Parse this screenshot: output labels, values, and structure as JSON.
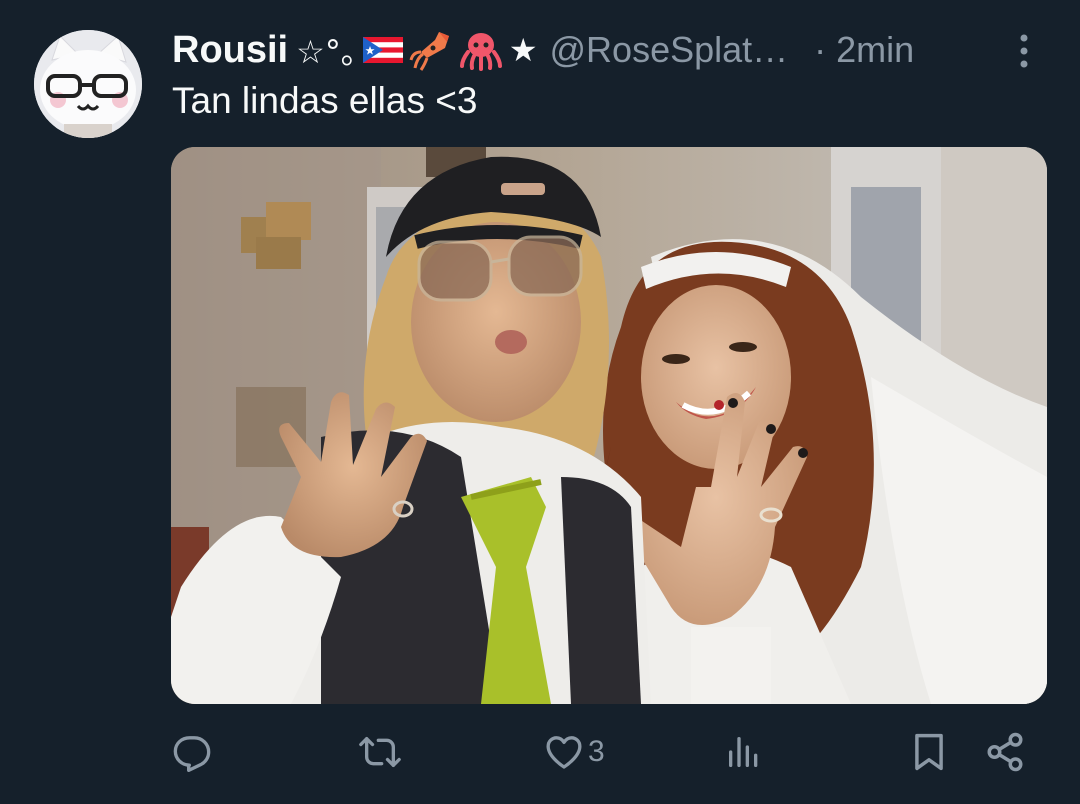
{
  "tweet": {
    "author": {
      "display_name": "Rousii",
      "name_decorations": "☆°｡",
      "emoji_icons": [
        "puerto-rico-flag-icon",
        "squid-icon",
        "octopus-icon"
      ],
      "name_trailing": "★",
      "handle": "@RoseSplat…",
      "avatar_icon": "cat-with-glasses-avatar-icon"
    },
    "time": "· 2min",
    "text": "Tan lindas ellas <3",
    "media_icon": "photo-two-women-showing-rings"
  },
  "actions": {
    "reply": {
      "icon": "reply-icon",
      "count": ""
    },
    "repost": {
      "icon": "repost-icon",
      "count": ""
    },
    "like": {
      "icon": "heart-icon",
      "count": "3"
    },
    "views": {
      "icon": "views-icon",
      "count": ""
    },
    "bookmark": {
      "icon": "bookmark-icon"
    },
    "share": {
      "icon": "share-icon"
    }
  },
  "colors": {
    "background": "#15202b",
    "primary_text": "#f7f9f9",
    "secondary_text": "#8b98a5"
  }
}
